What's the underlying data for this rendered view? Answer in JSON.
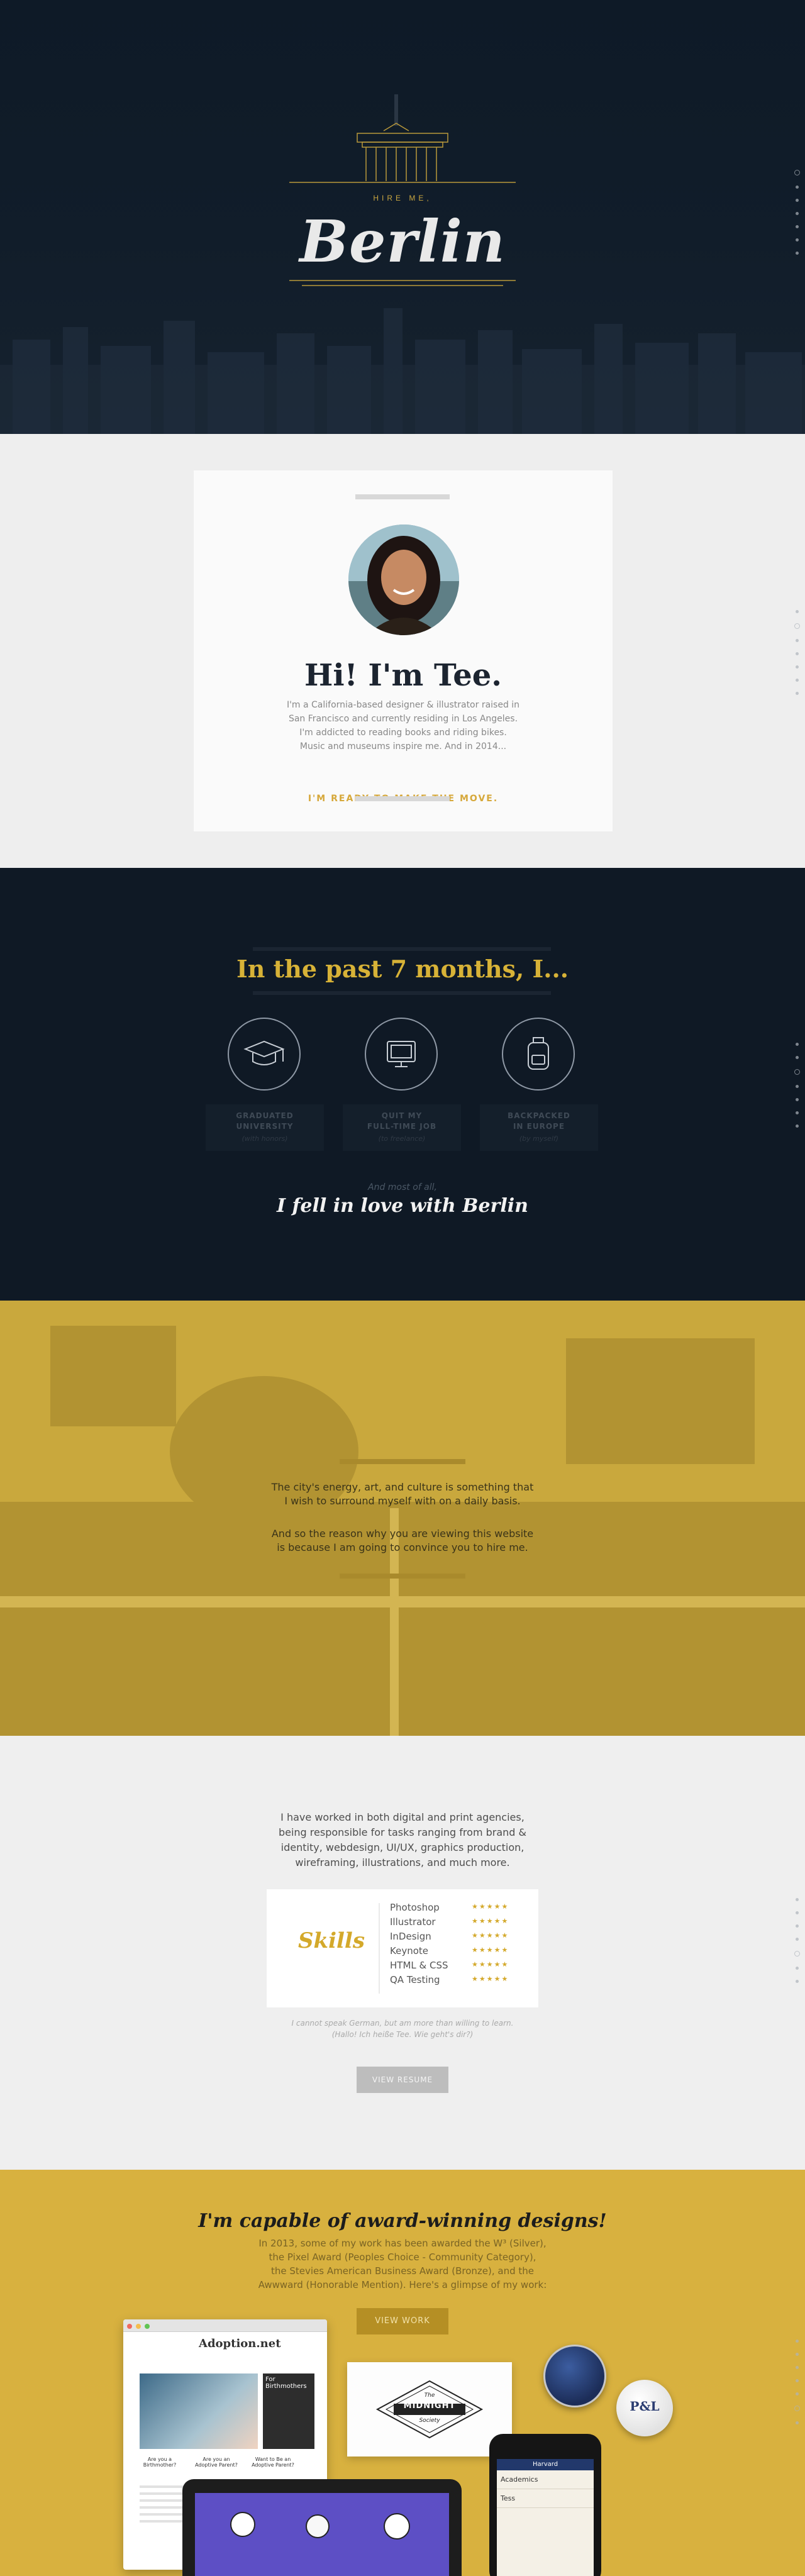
{
  "hero": {
    "kicker": "HIRE ME,",
    "title": "Berlin"
  },
  "intro": {
    "heading": "Hi! I'm Tee.",
    "bio_lines": [
      "I'm a California-based designer & illustrator raised in",
      "San Francisco and currently residing in Los Angeles.",
      "I'm addicted to reading books and riding bikes.",
      "Music and museums inspire me. And in 2014..."
    ],
    "cta": "I'M READY TO MAKE THE MOVE."
  },
  "past": {
    "heading": "In the past 7 months, I...",
    "items": [
      {
        "line1": "GRADUATED",
        "line2": "UNIVERSITY",
        "sub": "(with honors)",
        "icon": "graduation-cap-icon"
      },
      {
        "line1": "QUIT MY",
        "line2": "FULL-TIME JOB",
        "sub": "(to freelance)",
        "icon": "monitor-icon"
      },
      {
        "line1": "BACKPACKED",
        "line2": "IN EUROPE",
        "sub": "(by myself)",
        "icon": "backpack-icon"
      }
    ],
    "most": "And most of all,",
    "love": "I fell in love with Berlin"
  },
  "city": {
    "p1_a": "The city's energy, art, and culture is something that",
    "p1_b": "I wish to surround myself with on a daily basis.",
    "p2_a": "And so the reason why you are viewing this website",
    "p2_b": "is because I am going to convince you to hire me."
  },
  "skills": {
    "intro_lines": [
      "I have worked in both digital and print agencies,",
      "being responsible for tasks ranging from brand &",
      "identity, webdesign, UI/UX, graphics production,",
      "wireframing, illustrations, and much more."
    ],
    "title": "Skills",
    "list": [
      {
        "name": "Photoshop",
        "stars": "★★★★★"
      },
      {
        "name": "Illustrator",
        "stars": "★★★★★"
      },
      {
        "name": "InDesign",
        "stars": "★★★★★"
      },
      {
        "name": "Keynote",
        "stars": "★★★★★"
      },
      {
        "name": "HTML & CSS",
        "stars": "★★★★★"
      },
      {
        "name": "QA Testing",
        "stars": "★★★★★"
      }
    ],
    "note_a": "I cannot speak German, but am more than willing to learn.",
    "note_b": "(Hallo! Ich heiße Tee. Wie geht's dir?)",
    "button": "VIEW RESUME"
  },
  "awards": {
    "heading": "I'm capable of award-winning designs!",
    "intro_lines": [
      "In 2013, some of my work has been awarded the W³ (Silver),",
      "the Pixel Award (Peoples Choice - Community Category),",
      "the Stevies American Business Award (Bronze), and the",
      "Awwward (Honorable Mention). Here's a glimpse of my work:"
    ],
    "button": "VIEW WORK",
    "browser_brand": "Adoption.net",
    "browser_side": "For Birthmothers",
    "browser_q": [
      "Are you a Birthmother?",
      "Are you an Adoptive Parent?",
      "Want to Be an Adoptive Parent?"
    ],
    "midnight_top": "The",
    "midnight_mid": "MIDNIGHT",
    "midnight_bot": "Society",
    "badge_text": "P&L",
    "phone_title": "Harvard",
    "phone_rows": [
      "Academics",
      "Tess"
    ]
  },
  "colors": {
    "navy": "#0f1925",
    "gold": "#d7b237",
    "mustard": "#d8b13f"
  }
}
